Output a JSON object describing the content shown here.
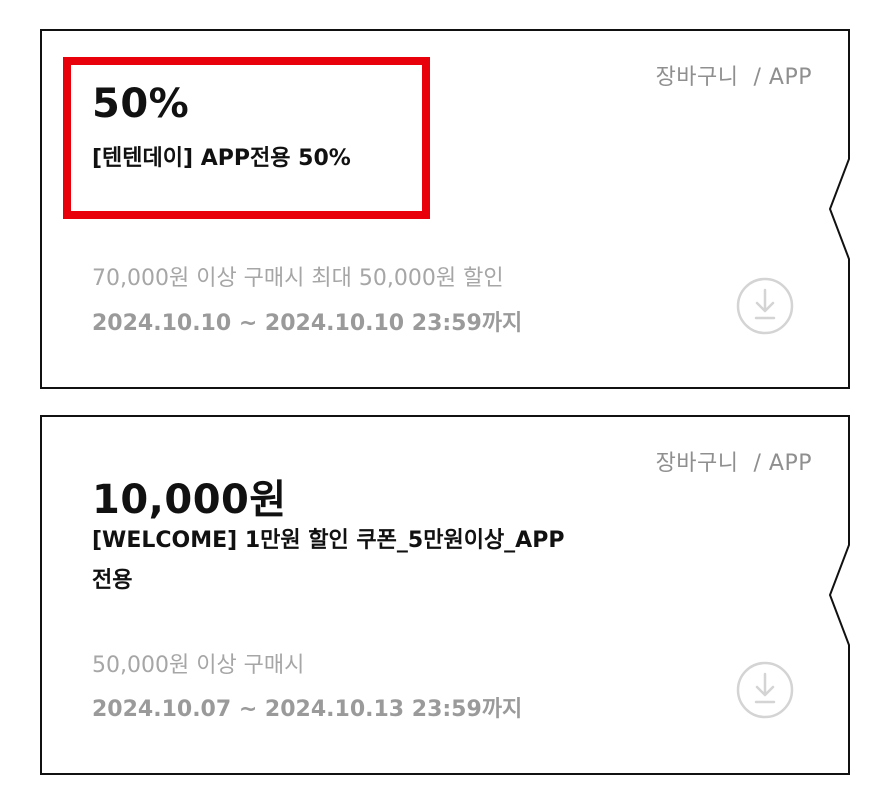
{
  "colors": {
    "text_primary": "#111111",
    "text_muted": "#a6a6a6",
    "highlight": "#e8000b",
    "border": "#111111",
    "icon": "#d4d4d4"
  },
  "coupons": [
    {
      "scope": "장바구니  / APP",
      "amount": "50%",
      "name": "[텐텐데이] APP전용 50%",
      "condition": "70,000원 이상 구매시 최대 50,000원 할인",
      "period": "2024.10.10 ~ 2024.10.10 23:59까지",
      "download_icon": "download-circle-icon",
      "highlighted": true
    },
    {
      "scope": "장바구니  / APP",
      "amount": "10,000원",
      "name_line1": "[WELCOME] 1만원 할인 쿠폰_5만원이상_APP",
      "name_line2": "전용",
      "condition": "50,000원 이상 구매시",
      "period": "2024.10.07 ~ 2024.10.13 23:59까지",
      "download_icon": "download-circle-icon",
      "highlighted": false
    }
  ]
}
